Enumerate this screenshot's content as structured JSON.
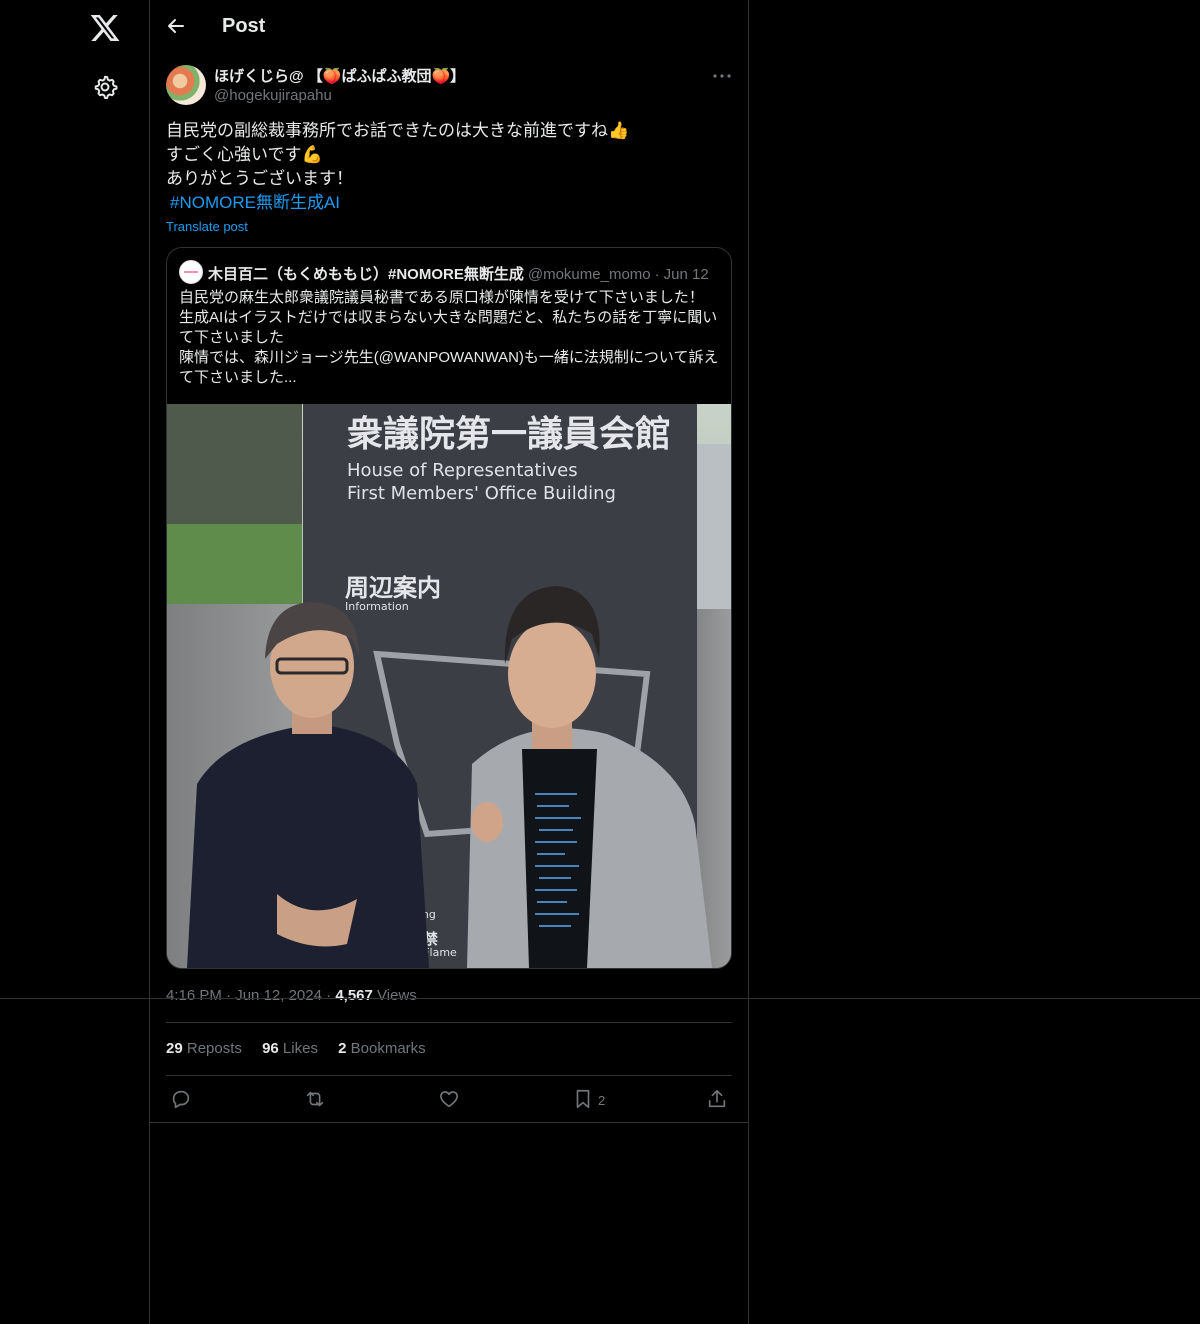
{
  "header": {
    "title": "Post"
  },
  "author": {
    "display_name": "ほげくじら@ 【🍑ぱふぱふ教団🍑】",
    "handle": "@hogekujirapahu"
  },
  "tweet": {
    "lines": [
      "自民党の副総裁事務所でお話できたのは大きな前進ですね👍",
      "すごく心強いです💪",
      "ありがとうございます！"
    ],
    "hashtag": "#NOMORE無断生成AI",
    "translate_label": "Translate post"
  },
  "quote": {
    "name": "木目百二（もくめももじ）#NOMORE無断生成",
    "handle": "@mokume_momo",
    "date": "Jun 12",
    "lines": [
      "自民党の麻生太郎衆議院議員秘書である原口様が陳情を受けて下さいました！",
      "生成AIはイラストだけでは収まらない大きな問題だと、私たちの話を丁寧に聞い",
      "て下さいました",
      "陳情では、森川ジョージ先生(@WANPOWANWAN)も一緒に法規制について訴え",
      "て下さいました..."
    ],
    "photo": {
      "sign_title_jp": "衆議院第一議員会館",
      "sign_title_en_1": "House of Representatives",
      "sign_title_en_2": "First Members' Office Building",
      "sign_info_jp": "周辺案内",
      "sign_info_en": "Information",
      "sign_bottom_1": "moking",
      "sign_bottom_2": "気厳禁",
      "sign_bottom_3": "pen Flame"
    }
  },
  "meta": {
    "time": "4:16 PM",
    "date": "Jun 12, 2024",
    "views_count": "4,567",
    "views_label": "Views"
  },
  "stats": {
    "reposts_count": "29",
    "reposts_label": "Reposts",
    "likes_count": "96",
    "likes_label": "Likes",
    "bookmarks_count": "2",
    "bookmarks_label": "Bookmarks"
  },
  "actions": {
    "bookmark_count": "2"
  },
  "colors": {
    "accent": "#1d9bf0",
    "text": "#e7e9ea",
    "muted": "#71767b",
    "border": "#2f3336",
    "background": "#000000"
  },
  "icons": [
    "x-logo-icon",
    "gear-icon",
    "back-arrow-icon",
    "more-icon",
    "reply-icon",
    "repost-icon",
    "like-icon",
    "bookmark-icon",
    "share-icon"
  ]
}
